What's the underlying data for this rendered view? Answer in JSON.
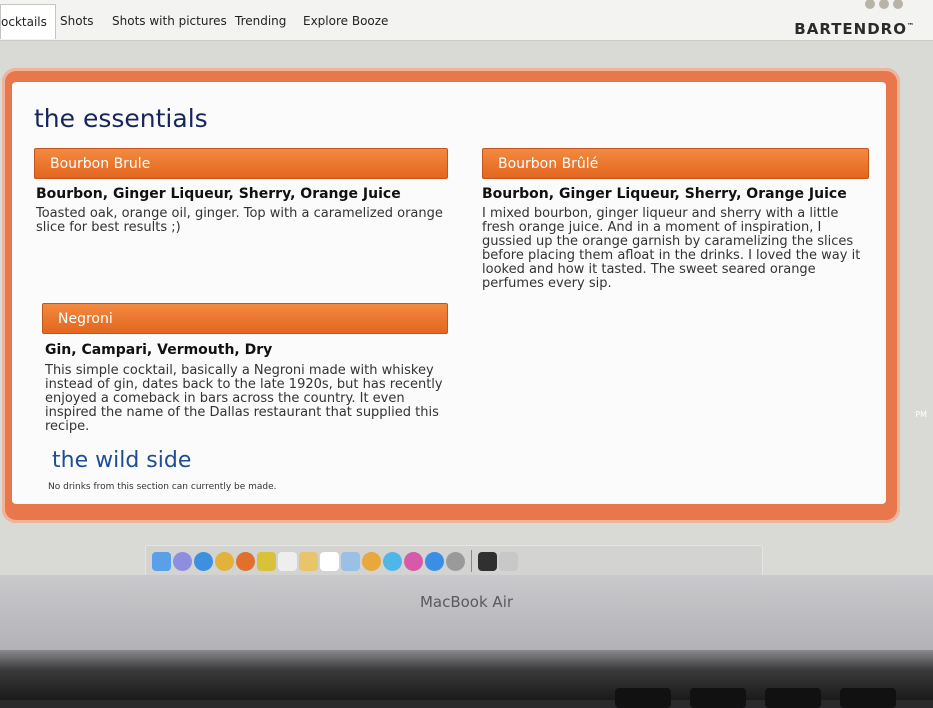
{
  "tabs": [
    "ocktails",
    "Shots",
    "Shots with pictures",
    "Trending",
    "Explore Booze"
  ],
  "brand": "BARTENDRO",
  "brand_mark": "™",
  "sections": {
    "essentials_title": "the essentials",
    "wild_title": "the wild side",
    "wild_note": "No drinks from this section can currently be made."
  },
  "drinks": [
    {
      "name": "Bourbon Brule",
      "ingredients": "Bourbon, Ginger Liqueur, Sherry, Orange Juice",
      "description": "Toasted oak, orange oil, ginger. Top with a caramelized orange slice for best results ;)"
    },
    {
      "name": "Bourbon Brûlé",
      "ingredients": "Bourbon, Ginger Liqueur, Sherry, Orange Juice",
      "description": "I mixed bourbon, ginger liqueur and sherry with a little fresh orange juice. And in a moment of inspiration, I gussied up the orange garnish by caramelizing the slices before placing them afloat in the drinks. I loved the way it looked and how it tasted. The sweet seared orange perfumes every sip."
    },
    {
      "name": "Negroni",
      "ingredients": "Gin, Campari, Vermouth, Dry",
      "description": "This simple cocktail, basically a Negroni made with whiskey instead of gin, dates back to the late 1920s, but has recently enjoyed a comeback in bars across the country. It even inspired the name of the Dallas restaurant that supplied this recipe."
    }
  ],
  "clock_fragment": "PM",
  "laptop_label": "MacBook Air",
  "colors": {
    "accent_orange": "#e8784b",
    "bar_orange": "#ec7630",
    "heading_navy": "#16255e",
    "heading_blue": "#1f4d94"
  },
  "dock_icons": [
    "finder-icon",
    "launchpad-icon",
    "safari-icon",
    "chrome-icon",
    "firefox-icon",
    "app-icon",
    "notes-icon",
    "stickies-icon",
    "calendar-icon",
    "preview-icon",
    "photos-icon",
    "messages-icon",
    "itunes-icon",
    "appstore-icon",
    "settings-icon",
    "terminal-icon",
    "trash-icon"
  ]
}
